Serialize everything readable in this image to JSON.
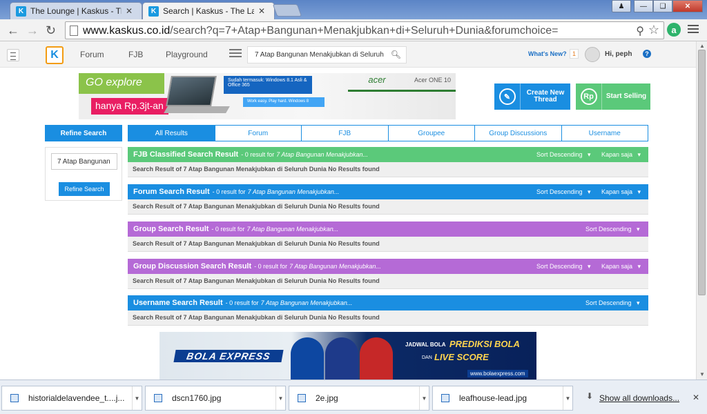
{
  "browser": {
    "tabs": [
      {
        "title": "The Lounge | Kaskus - The",
        "active": false
      },
      {
        "title": "Search | Kaskus - The Larg",
        "active": true
      }
    ],
    "url_host": "www.kaskus.co.id",
    "url_path": "/search?q=7+Atap+Bangunan+Menakjubkan+di+Seluruh+Dunia&forumchoice="
  },
  "site": {
    "nav": [
      "Forum",
      "FJB",
      "Playground"
    ],
    "search_value": "7 Atap Bangunan Menakjubkan di Seluruh",
    "whats_new": "What's New?",
    "notif_count": "1",
    "greeting": "Hi, peph"
  },
  "banner": {
    "go_explore": "GO explore",
    "price": "hanya Rp.3jt-an",
    "windows": "Sudah termasuk: Windows 8.1 Asli & Office 365",
    "work": "Work easy. Play hard. Windows 8",
    "brand": "acer",
    "model": "Acer ONE 10"
  },
  "actions": {
    "create_thread": "Create New Thread",
    "start_selling": "Start Selling"
  },
  "sidebar": {
    "header": "Refine Search",
    "input_value": "7 Atap Bangunan",
    "button": "Refine Search"
  },
  "tabs": [
    "All Results",
    "Forum",
    "FJB",
    "Groupee",
    "Group Discussions",
    "Username"
  ],
  "sections": [
    {
      "title": "FJB Classified Search Result",
      "result": "- 0 result for",
      "query": "7 Atap Bangunan Menakjubkan...",
      "sort": "Sort Descending",
      "time": "Kapan saja",
      "body": "Search Result of 7 Atap Bangunan Menakjubkan di Seluruh Dunia No Results found"
    },
    {
      "title": "Forum Search Result",
      "result": "- 0 result for",
      "query": "7 Atap Bangunan Menakjubkan...",
      "sort": "Sort Descending",
      "time": "Kapan saja",
      "body": "Search Result of 7 Atap Bangunan Menakjubkan di Seluruh Dunia No Results found"
    },
    {
      "title": "Group Search Result",
      "result": "- 0 result for",
      "query": "7 Atap Bangunan Menakjubkan...",
      "sort": "Sort Descending",
      "time": "",
      "body": "Search Result of 7 Atap Bangunan Menakjubkan di Seluruh Dunia No Results found"
    },
    {
      "title": "Group Discussion Search Result",
      "result": "- 0 result for",
      "query": "7 Atap Bangunan Menakjubkan...",
      "sort": "Sort Descending",
      "time": "Kapan saja",
      "body": "Search Result of 7 Atap Bangunan Menakjubkan di Seluruh Dunia No Results found"
    },
    {
      "title": "Username Search Result",
      "result": "- 0 result for",
      "query": "7 Atap Bangunan Menakjubkan...",
      "sort": "Sort Descending",
      "time": "",
      "body": "Search Result of 7 Atap Bangunan Menakjubkan di Seluruh Dunia No Results found"
    }
  ],
  "bola": {
    "logo": "BOLA EXPRESS",
    "jadwal": "JADWAL BOLA",
    "prediksi": "PREDIKSI BOLA",
    "dan": "DAN",
    "live": "LIVE SCORE",
    "url": "www.bolaexpress.com"
  },
  "downloads": {
    "items": [
      "historialdelavendee_t....j...",
      "dscn1760.jpg",
      "2e.jpg",
      "leafhouse-lead.jpg"
    ],
    "show_all": "Show all downloads..."
  },
  "colors": {
    "kaskus_blue": "#1a8ee1",
    "green": "#5bc97a",
    "purple": "#b56ad6"
  }
}
